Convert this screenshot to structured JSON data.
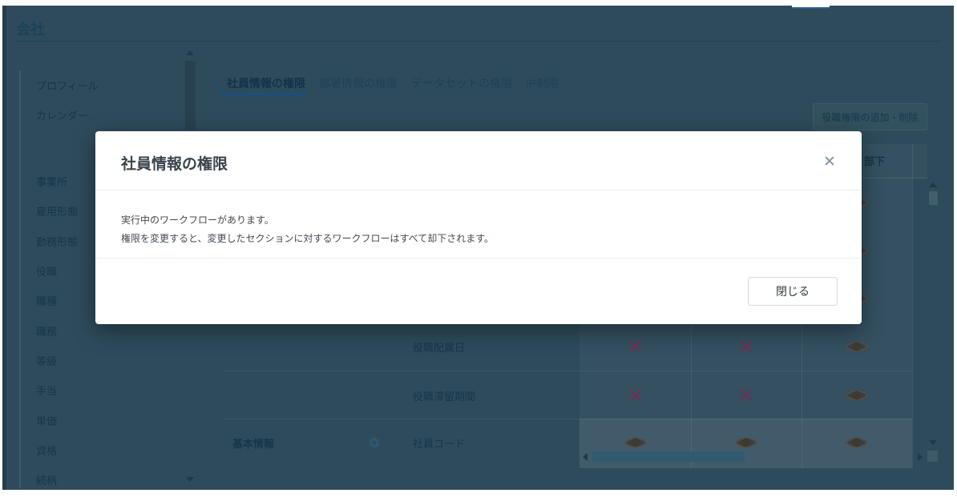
{
  "app": {
    "title": "会社"
  },
  "sidebar": {
    "group_top": [
      {
        "label": "プロフィール"
      },
      {
        "label": "カレンダー"
      }
    ],
    "group_main": [
      {
        "label": "事業所"
      },
      {
        "label": "雇用形態"
      },
      {
        "label": "勤務形態"
      },
      {
        "label": "役職"
      },
      {
        "label": "職種"
      },
      {
        "label": "職務"
      },
      {
        "label": "等級"
      },
      {
        "label": "手当"
      },
      {
        "label": "単価"
      },
      {
        "label": "資格"
      },
      {
        "label": "続柄"
      }
    ]
  },
  "tabs": {
    "items": [
      {
        "label": "社員情報の権限",
        "active": true
      },
      {
        "label": "部署情報の権限",
        "active": false
      },
      {
        "label": "データセットの権限",
        "active": false
      },
      {
        "label": "IP制限",
        "active": false
      }
    ]
  },
  "toolbar": {
    "add_remove_label": "役職権限の追加・削除"
  },
  "permissions_table": {
    "visible_column_header": "部下",
    "rows": [
      {
        "field": "役職配属日",
        "cells": [
          "deny",
          "deny",
          "view"
        ]
      },
      {
        "field": "役職滞留期間",
        "cells": [
          "deny",
          "deny",
          "view"
        ]
      },
      {
        "section": "基本情報",
        "field": "社員コード",
        "cells": [
          "view",
          "view",
          "view"
        ],
        "highlighted": true
      }
    ]
  },
  "modal": {
    "title": "社員情報の権限",
    "message_lines": [
      "実行中のワークフローがあります。",
      "権限を変更すると、変更したセクションに対するワークフローはすべて却下されます。"
    ],
    "close_icon": "✕",
    "close_button_label": "閉じる"
  },
  "colors": {
    "backdrop_dim": "#2e4b5c",
    "tab_accent_blue": "#1d4e7e",
    "deny_x_pink": "#6e3156",
    "view_eye_amber": "#5c4a38",
    "modal_bg": "#ffffff",
    "notch_blue": "#2a5f8e"
  }
}
